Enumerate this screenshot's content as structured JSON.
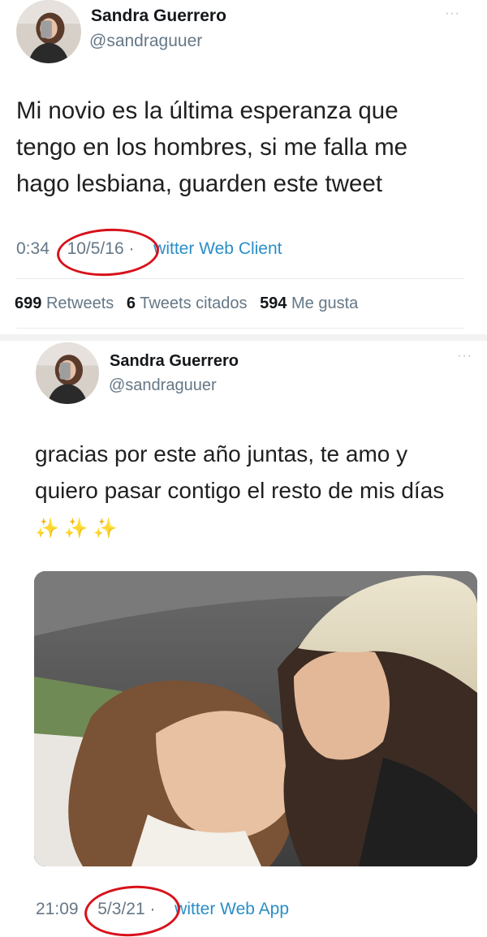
{
  "tweets": [
    {
      "author_name": "Sandra Guerrero",
      "author_handle": "@sandraguuer",
      "more_glyph": "···",
      "text": "Mi novio es la última esperanza que tengo en los hombres, si me falla me hago lesbiana, guarden este tweet",
      "time": "0:34",
      "date": "10/5/16",
      "sep": "·",
      "source": "witter Web Client",
      "stats": {
        "retweets_count": "699",
        "retweets_label": "Retweets",
        "quotes_count": "6",
        "quotes_label": "Tweets citados",
        "likes_count": "594",
        "likes_label": "Me gusta"
      }
    },
    {
      "author_name": "Sandra Guerrero",
      "author_handle": "@sandraguuer",
      "more_glyph": "···",
      "text": "gracias por este año juntas, te amo y quiero pasar contigo el resto de mis días",
      "emoji": "✨✨✨",
      "time": "21:09",
      "date": "5/3/21",
      "sep": "·",
      "source": "witter Web App"
    }
  ],
  "colors": {
    "link": "#2a8ec7",
    "annotation_circle": "#d8111b",
    "secondary_text": "#657786"
  },
  "icons": {
    "more": "more-options-icon",
    "sparkles": "sparkles-icon"
  }
}
